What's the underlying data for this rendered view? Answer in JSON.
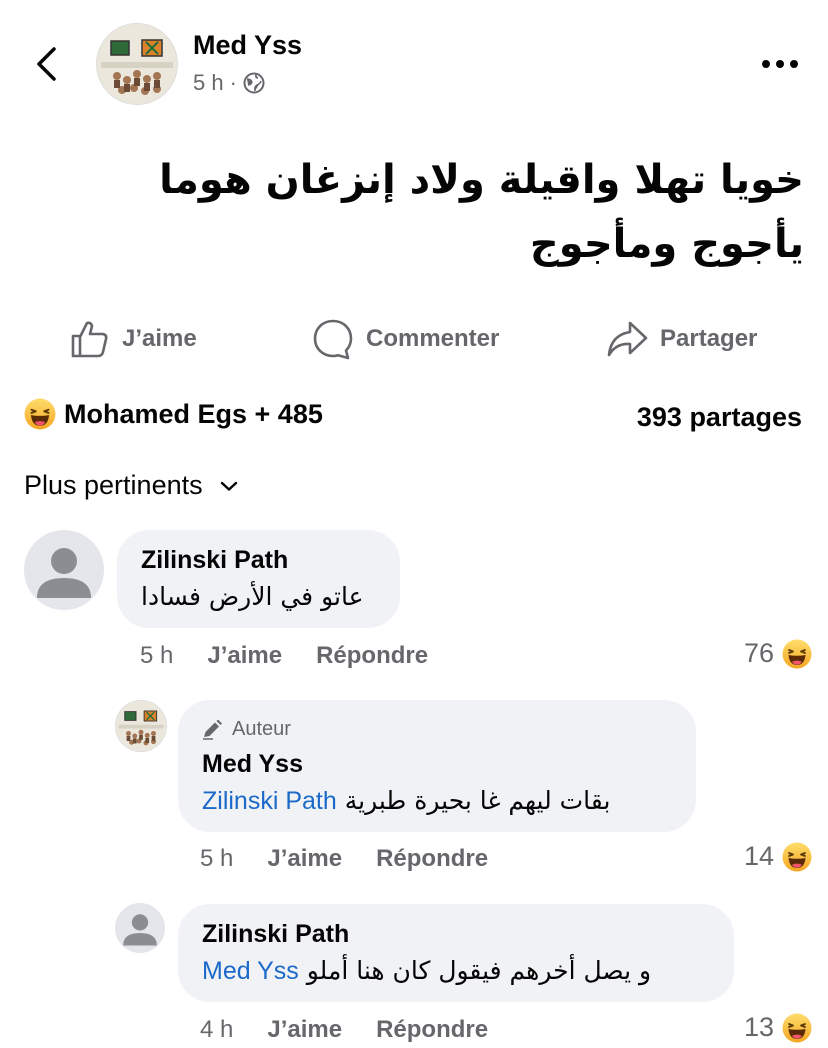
{
  "post": {
    "author": "Med Yss",
    "time": "5 h",
    "dot": "·",
    "text": "خويا تهلا واقيلة ولاد إنزغان هوما يأجوج ومأجوج"
  },
  "actions": {
    "like": "J’aime",
    "comment": "Commenter",
    "share": "Partager"
  },
  "summary": {
    "reactions_text": "Mohamed Egs + 485",
    "shares_text": "393 partages"
  },
  "sort": {
    "label": "Plus pertinents"
  },
  "comments": [
    {
      "author": "Zilinski Path",
      "text": "عاتو في الأرض فسادا",
      "time": "5 h",
      "like": "J’aime",
      "reply": "Répondre",
      "reactions": "76"
    },
    {
      "badge": "Auteur",
      "author": "Med Yss",
      "mention": "Zilinski Path",
      "text": "بقات ليهم غا بحيرة طبرية",
      "time": "5 h",
      "like": "J’aime",
      "reply": "Répondre",
      "reactions": "14"
    },
    {
      "author": "Zilinski Path",
      "mention": "Med Yss",
      "text": "و يصل أخرهم فيقول كان هنا أملو",
      "time": "4 h",
      "like": "J’aime",
      "reply": "Répondre",
      "reactions": "13"
    }
  ],
  "icons": {
    "back": "chevron-left-icon",
    "more": "more-dots-icon",
    "audience": "globe-icon",
    "like": "thumbs-up-icon",
    "comment": "comment-icon",
    "share": "share-icon",
    "reaction": "haha-emoji-icon",
    "dropdown": "chevron-down-icon",
    "author_badge": "pen-icon"
  },
  "colors": {
    "mention": "#1b6ac9",
    "secondary_text": "#65676b",
    "bubble": "#f0f2f5"
  }
}
